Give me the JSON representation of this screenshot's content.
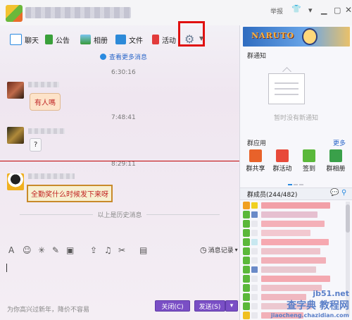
{
  "title_bar": {
    "report": "举报"
  },
  "toolbar": {
    "chat": "聊天",
    "notice": "公告",
    "album": "相册",
    "files": "文件",
    "activity": "活动"
  },
  "chat": {
    "more_messages": "查看更多消息",
    "times": [
      "6:30:16",
      "7:48:41",
      "8:29:11"
    ],
    "messages": [
      "有人嗎",
      "?",
      "全勤奖什么时候发下来呀"
    ],
    "history_label": "以上是历史消息"
  },
  "input": {
    "message_record": "消息记录",
    "footer_hint": "为你高兴过新年，降价不容易",
    "close_label": "关闭(C)",
    "send_label": "发送(S)"
  },
  "right_panel": {
    "banner_logo": "NARUTO",
    "notice_title": "群通知",
    "no_notice": "暂时没有新通知",
    "apps_title": "群应用",
    "more_label": "更多",
    "apps": [
      "群共享",
      "群活动",
      "签到",
      "群相册"
    ],
    "members_title": "群成员(244/482)"
  },
  "watermark": {
    "line1": "jb51.net",
    "line2": "查字典 教程网",
    "line3": "jiaocheng.chazidian.com"
  },
  "colors": {
    "send_button": "#7a4fc5",
    "highlight_box": "#e01010",
    "link": "#2a66c9"
  }
}
